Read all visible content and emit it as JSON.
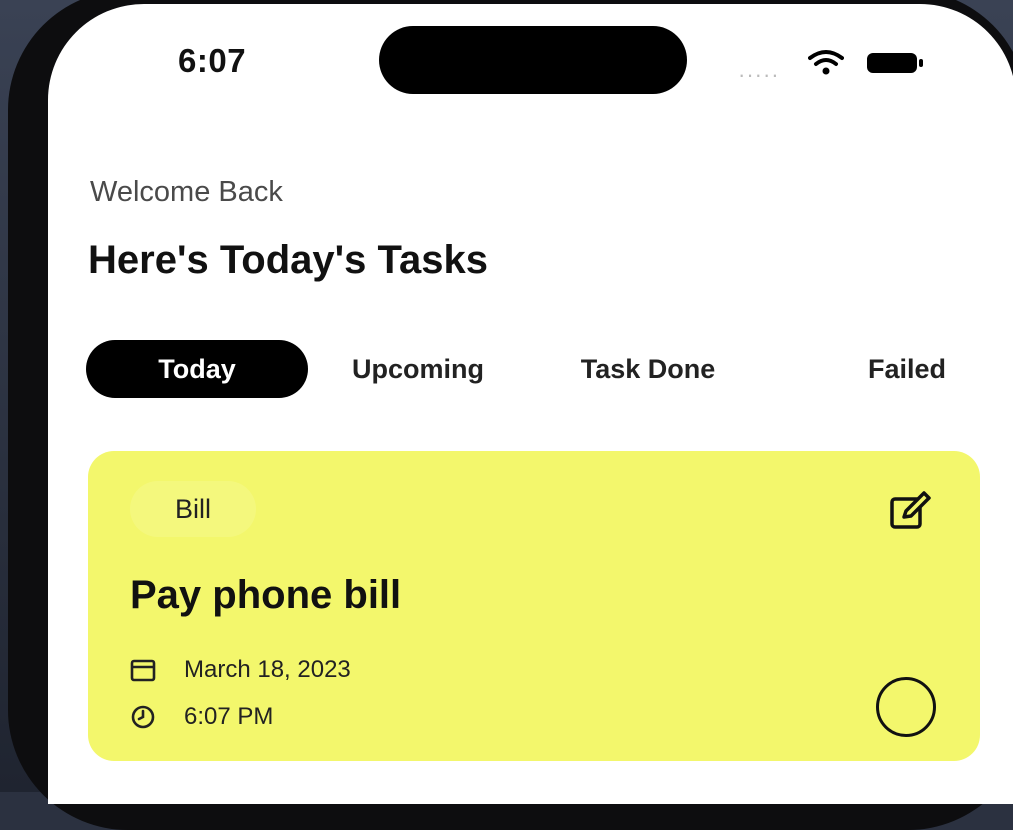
{
  "status_bar": {
    "time": "6:07",
    "signal_dots": "·····"
  },
  "header": {
    "welcome": "Welcome Back",
    "headline": "Here's Today's Tasks"
  },
  "tabs": [
    {
      "label": "Today",
      "active": true
    },
    {
      "label": "Upcoming",
      "active": false
    },
    {
      "label": "Task Done",
      "active": false
    },
    {
      "label": "Failed",
      "active": false
    }
  ],
  "task_card": {
    "tag": "Bill",
    "title": "Pay phone bill",
    "date": "March 18, 2023",
    "time": "6:07 PM",
    "background_color": "#f3f76c",
    "icons": {
      "edit": "edit-icon",
      "date": "calendar-icon",
      "time": "clock-icon",
      "complete": "complete-circle-icon"
    }
  },
  "colors": {
    "accent": "#000000",
    "card": "#f3f76c",
    "text": "#111111"
  }
}
